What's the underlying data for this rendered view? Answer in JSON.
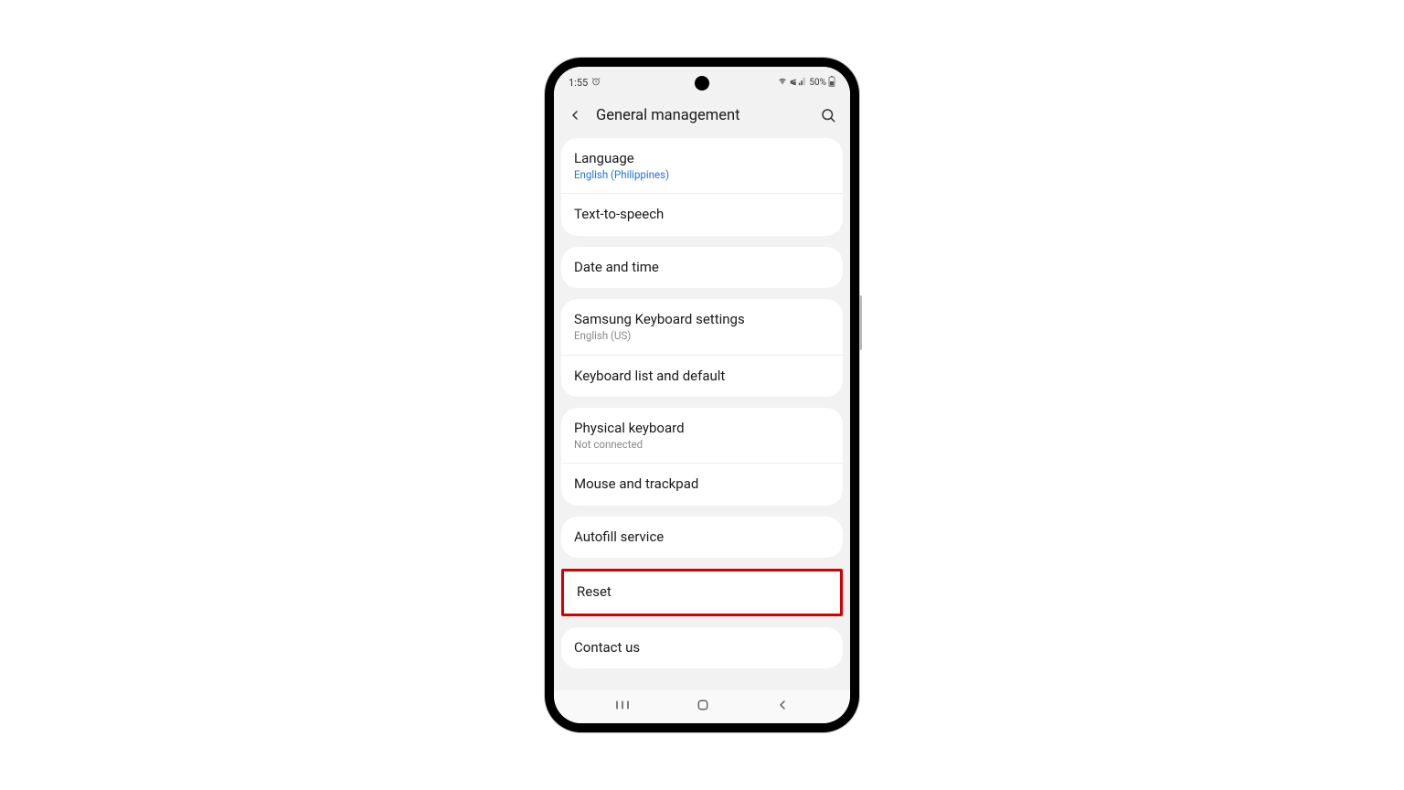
{
  "statusBar": {
    "time": "1:55",
    "battery": "50%"
  },
  "header": {
    "title": "General management"
  },
  "groups": [
    {
      "items": [
        {
          "title": "Language",
          "subtitle": "English (Philippines)",
          "subClass": "blue"
        },
        {
          "title": "Text-to-speech"
        }
      ]
    },
    {
      "items": [
        {
          "title": "Date and time"
        }
      ]
    },
    {
      "items": [
        {
          "title": "Samsung Keyboard settings",
          "subtitle": "English (US)"
        },
        {
          "title": "Keyboard list and default"
        }
      ]
    },
    {
      "items": [
        {
          "title": "Physical keyboard",
          "subtitle": "Not connected"
        },
        {
          "title": "Mouse and trackpad"
        }
      ]
    },
    {
      "items": [
        {
          "title": "Autofill service"
        }
      ]
    },
    {
      "highlighted": true,
      "items": [
        {
          "title": "Reset"
        }
      ]
    },
    {
      "items": [
        {
          "title": "Contact us"
        }
      ]
    }
  ]
}
